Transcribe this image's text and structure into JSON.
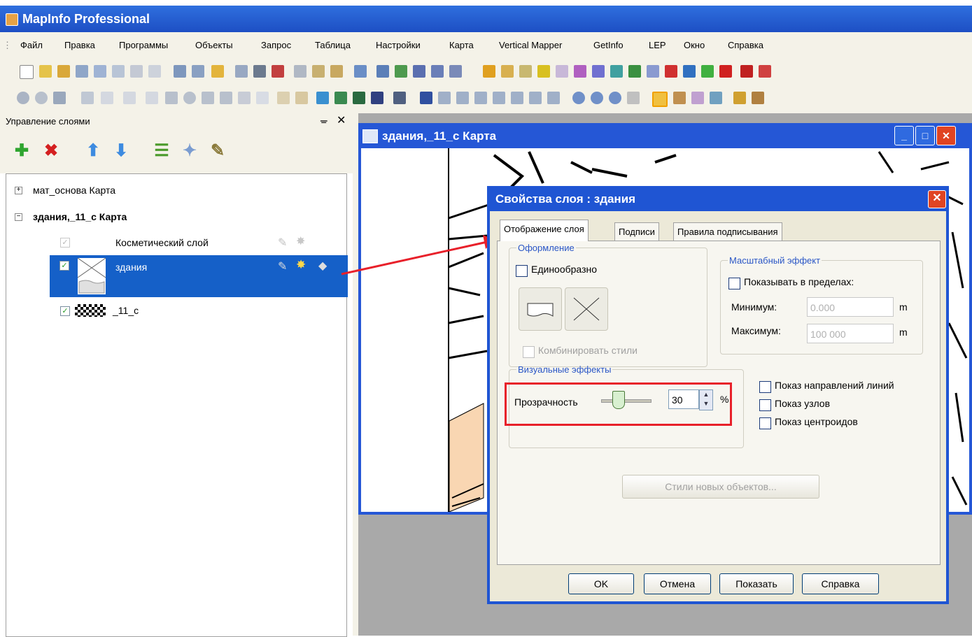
{
  "app": {
    "title": "MapInfo Professional"
  },
  "menu": [
    "Файл",
    "Правка",
    "Программы",
    "Объекты",
    "Запрос",
    "Таблица",
    "Настройки",
    "Карта",
    "Vertical Mapper",
    "GetInfo",
    "LEP",
    "Окно",
    "Справка"
  ],
  "layer_panel": {
    "title": "Управление слоями",
    "pin": "ᚚ",
    "close": "✕",
    "tree": {
      "mat_label": "мат_основа Карта",
      "zdaniya_map_label": "здания,_11_с Карта",
      "cosmetic_label": "Косметический слой",
      "zdaniya_label": "здания",
      "raster_label": "_11_с"
    }
  },
  "map_window": {
    "title": "здания,_11_с Карта"
  },
  "dialog": {
    "title": "Свойства слоя  : здания",
    "tabs": [
      "Отображение слоя",
      "Подписи",
      "Правила подписывания"
    ],
    "style_group": {
      "legend": "Оформление",
      "uniform_label": "Единообразно",
      "combine_label": "Комбинировать стили"
    },
    "scale_group": {
      "legend": "Масштабный эффект",
      "show_within_label": "Показывать в пределах:",
      "min_label": "Минимум:",
      "min_value": "0.000",
      "max_label": "Максимум:",
      "max_value": "100 000",
      "unit": "m"
    },
    "visual_group": {
      "legend": "Визуальные эффекты",
      "transparency_label": "Прозрачность",
      "transparency_value": "30",
      "percent": "%"
    },
    "options": {
      "line_dir_label": "Показ направлений линий",
      "nodes_label": "Показ узлов",
      "centroids_label": "Показ центроидов"
    },
    "new_styles_button": "Стили новых объектов...",
    "buttons": {
      "ok": "OK",
      "cancel": "Отмена",
      "show": "Показать",
      "help": "Справка"
    }
  },
  "colors": {
    "title_blue": "#2557d6",
    "selection_blue": "#1560c8",
    "highlight_red": "#e8202a",
    "dialog_bg": "#ece9d8"
  }
}
